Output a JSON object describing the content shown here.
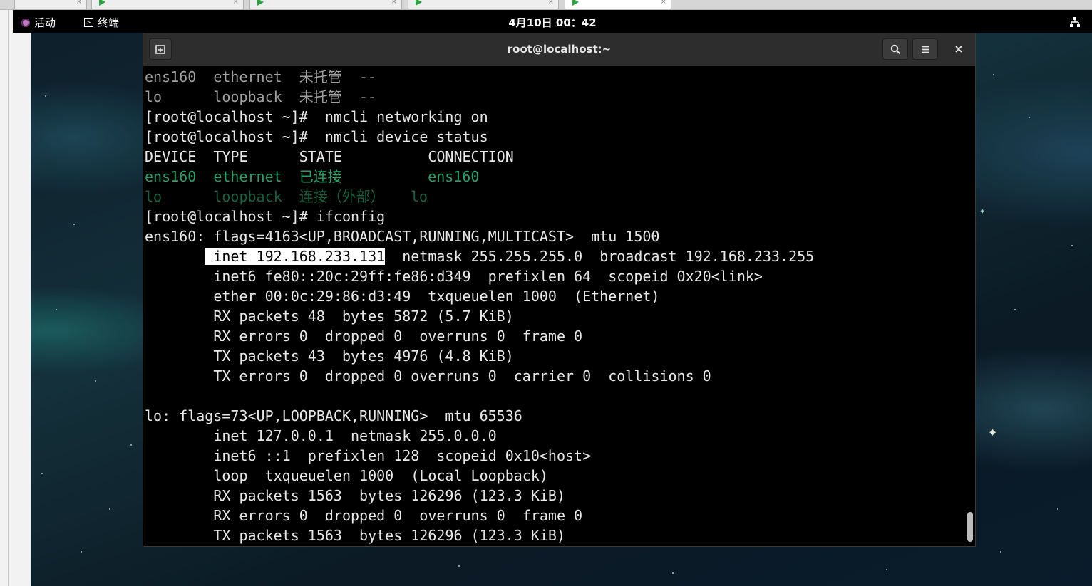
{
  "topbar": {
    "activities": "活动",
    "app_name": "终端",
    "clock": "4月10日 00：42"
  },
  "window": {
    "title": "root@localhost:~"
  },
  "terminal": {
    "lines": [
      {
        "text": "ens160  ethernet  未托管  --",
        "style": "dim"
      },
      {
        "text": "lo      loopback  未托管  --",
        "style": "dim"
      },
      {
        "text": "[root@localhost ~]#  nmcli networking on",
        "style": "normal"
      },
      {
        "text": "[root@localhost ~]#  nmcli device status",
        "style": "normal"
      },
      {
        "text": "DEVICE  TYPE      STATE          CONNECTION",
        "style": "normal"
      },
      {
        "text": "ens160  ethernet  已连接          ens160",
        "style": "green"
      },
      {
        "text": "lo      loopback  连接（外部）   lo",
        "style": "green-dim"
      },
      {
        "text": "[root@localhost ~]# ifconfig",
        "style": "normal"
      },
      {
        "text": "ens160: flags=4163<UP,BROADCAST,RUNNING,MULTICAST>  mtu 1500",
        "style": "normal"
      },
      {
        "prefix": "       ",
        "highlight": " inet 192.168.233.131",
        "text": "  netmask 255.255.255.0  broadcast 192.168.233.255",
        "style": "highlight"
      },
      {
        "text": "        inet6 fe80::20c:29ff:fe86:d349  prefixlen 64  scopeid 0x20<link>",
        "style": "normal"
      },
      {
        "text": "        ether 00:0c:29:86:d3:49  txqueuelen 1000  (Ethernet)",
        "style": "normal"
      },
      {
        "text": "        RX packets 48  bytes 5872 (5.7 KiB)",
        "style": "normal"
      },
      {
        "text": "        RX errors 0  dropped 0  overruns 0  frame 0",
        "style": "normal"
      },
      {
        "text": "        TX packets 43  bytes 4976 (4.8 KiB)",
        "style": "normal"
      },
      {
        "text": "        TX errors 0  dropped 0 overruns 0  carrier 0  collisions 0",
        "style": "normal"
      },
      {
        "text": "",
        "style": "normal"
      },
      {
        "text": "lo: flags=73<UP,LOOPBACK,RUNNING>  mtu 65536",
        "style": "normal"
      },
      {
        "text": "        inet 127.0.0.1  netmask 255.0.0.0",
        "style": "normal"
      },
      {
        "text": "        inet6 ::1  prefixlen 128  scopeid 0x10<host>",
        "style": "normal"
      },
      {
        "text": "        loop  txqueuelen 1000  (Local Loopback)",
        "style": "normal"
      },
      {
        "text": "        RX packets 1563  bytes 126296 (123.3 KiB)",
        "style": "normal"
      },
      {
        "text": "        RX errors 0  dropped 0  overruns 0  frame 0",
        "style": "normal"
      },
      {
        "text": "        TX packets 1563  bytes 126296 (123.3 KiB)",
        "style": "normal"
      }
    ]
  },
  "icons": {
    "activities": "gnome-activities-icon",
    "app": "terminal-app-icon",
    "network": "network-wired-icon",
    "new_tab": "new-tab-icon",
    "search": "search-icon",
    "menu": "hamburger-menu-icon",
    "close": "close-icon"
  },
  "colors": {
    "green_output": "#26a269",
    "terminal_bg": "#000000",
    "headerbar_bg": "#2d2d2d"
  }
}
